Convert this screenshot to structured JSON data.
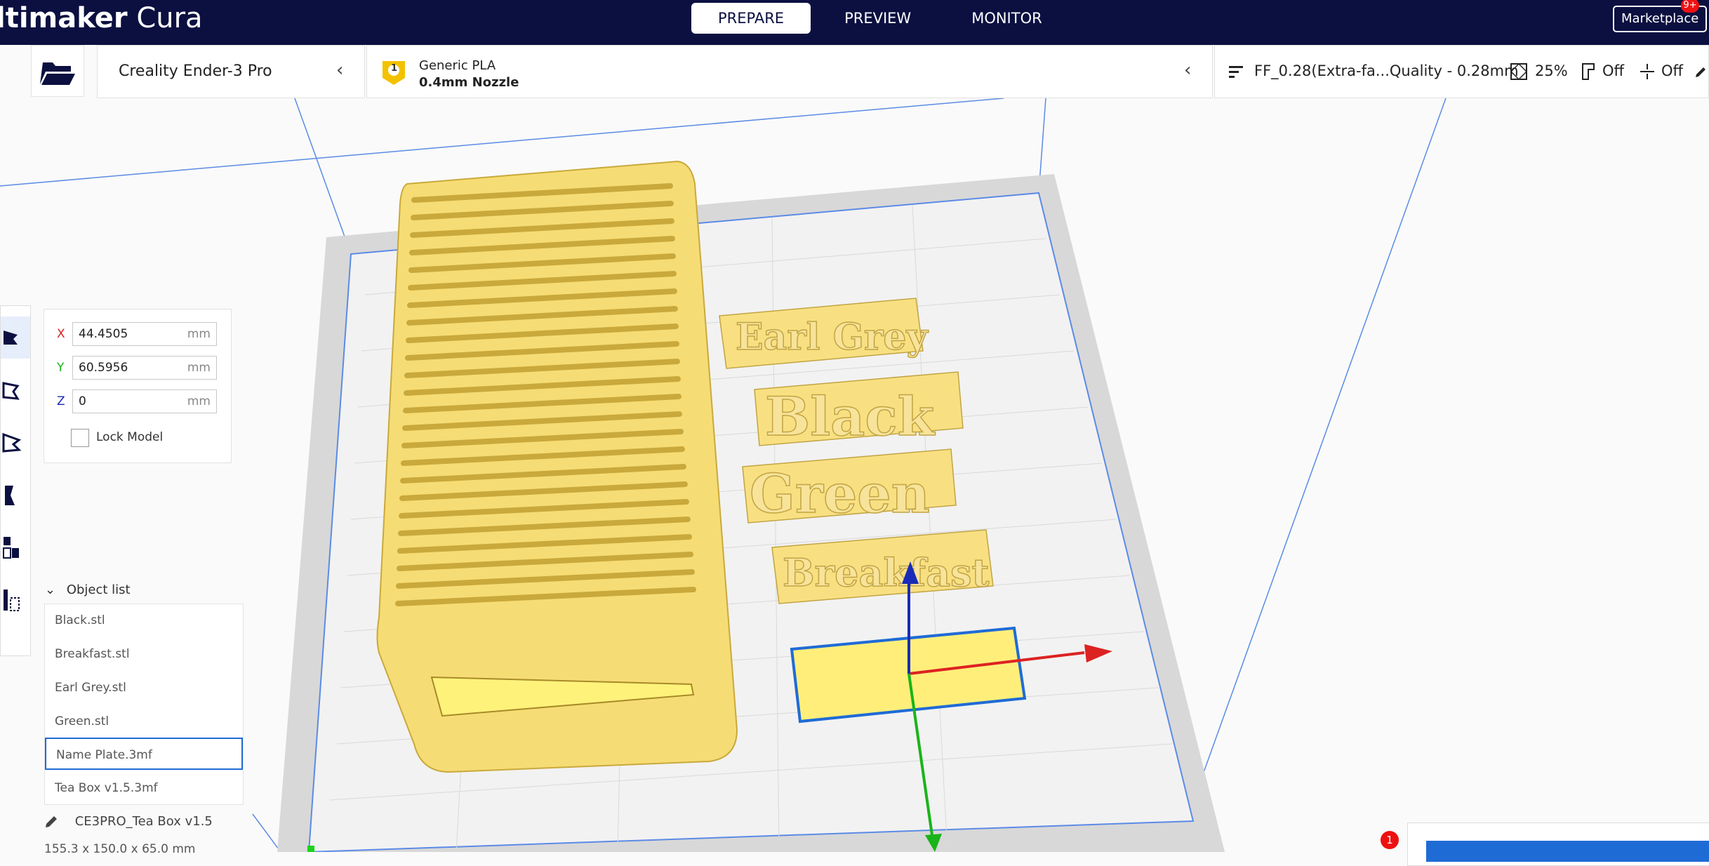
{
  "app": {
    "title_prefix": "ltimaker",
    "title_suffix": "Cura"
  },
  "tabs": [
    {
      "label": "PREPARE"
    },
    {
      "label": "PREVIEW"
    },
    {
      "label": "MONITOR"
    }
  ],
  "marketplace": {
    "label": "Marketplace",
    "badge": "9+"
  },
  "printer": {
    "name": "Creality Ender-3 Pro"
  },
  "material": {
    "extruder": "1",
    "name": "Generic PLA",
    "nozzle": "0.4mm Nozzle"
  },
  "print_settings": {
    "profile": "FF_0.28(Extra-fa...Quality - 0.28mm",
    "infill": "25%",
    "support": "Off",
    "adhesion": "Off"
  },
  "move_tool": {
    "x": {
      "label": "X",
      "value": "44.4505",
      "unit": "mm"
    },
    "y": {
      "label": "Y",
      "value": "60.5956",
      "unit": "mm"
    },
    "z": {
      "label": "Z",
      "value": "0",
      "unit": "mm"
    },
    "lock_label": "Lock Model"
  },
  "object_list": {
    "title": "Object list",
    "items": [
      {
        "label": "Black.stl"
      },
      {
        "label": "Breakfast.stl"
      },
      {
        "label": "Earl Grey.stl"
      },
      {
        "label": "Green.stl"
      },
      {
        "label": "Name Plate.3mf"
      },
      {
        "label": "Tea Box v1.5.3mf"
      }
    ],
    "selected": "Name Plate.3mf"
  },
  "project": {
    "name": "CE3PRO_Tea Box v1.5",
    "dimensions": "155.3 x 150.0 x 65.0 mm"
  },
  "scene_labels": [
    "Earl Grey",
    "Black",
    "Green",
    "Breakfast"
  ],
  "notification_count": "1",
  "colors": {
    "topbar": "#0b1040",
    "model": "#f6dc74",
    "selection": "#1f6bd6"
  },
  "icons": [
    "folder-open-icon",
    "extruder-icon",
    "profile-icon",
    "infill-icon",
    "support-icon",
    "adhesion-icon",
    "edit-icon",
    "move-tool-icon",
    "scale-tool-icon",
    "rotate-tool-icon",
    "mirror-tool-icon",
    "per-model-settings-icon",
    "support-blocker-icon",
    "chevron-left-icon",
    "chevron-down-icon",
    "pencil-icon"
  ]
}
